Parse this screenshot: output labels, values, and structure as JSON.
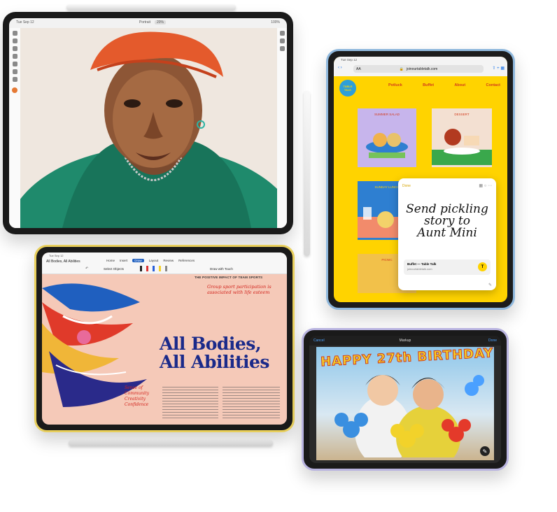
{
  "ipad_pro": {
    "status_time": "Tue Sep 12",
    "doc_title": "Portrait",
    "zoom": "20%",
    "battery": "100%"
  },
  "ipad_blue": {
    "status_time": "Tue Sep 12",
    "url": "joinourtabletalk.com",
    "reader_label": "AA",
    "logo": "TABLE TALK",
    "nav": [
      "Potluck",
      "Buffet",
      "About",
      "Contact"
    ],
    "cards": [
      "SUMMER SALAD",
      "DESSERT",
      "SUNDAY LUNCH",
      "PICNIC"
    ],
    "note_done": "Done",
    "note_text_lines": [
      "Send pickling",
      "story to",
      "Aunt Mini"
    ],
    "link_title": "Buffet — Table Talk",
    "link_url": "joinourtabletalk.com",
    "link_badge": "T"
  },
  "ipad_yellow": {
    "status_time": "Tue Sep 12",
    "doc_name": "All Bodies, All Abilities",
    "tabs": [
      "Home",
      "Insert",
      "Draw",
      "Layout",
      "Review",
      "References"
    ],
    "active_tab": "Draw",
    "select_objects": "Select Objects",
    "draw_touch": "Draw with Touch",
    "kicker": "THE POSITIVE IMPACT OF TEAM SPORTS",
    "handwritten_note": "Group sport participation is associated with life esteem",
    "headline_1": "All Bodies,",
    "headline_2": "All Abilities",
    "margin_note_title": "Sense of",
    "margin_note_items": [
      "Community",
      "Creativity",
      "Confidence"
    ]
  },
  "ipad_mini": {
    "title": "Markup",
    "cancel": "Cancel",
    "done": "Done",
    "banner": "HAPPY 27th BIRTHDAY!!!"
  },
  "colors": {
    "web_yellow": "#ffd300",
    "ipad_blue_frame": "#8fb8dd",
    "ipad_yellow_frame": "#e8cf5c",
    "ipad_mini_frame": "#b9b4e0",
    "poster_pink": "#f5c9b8"
  }
}
